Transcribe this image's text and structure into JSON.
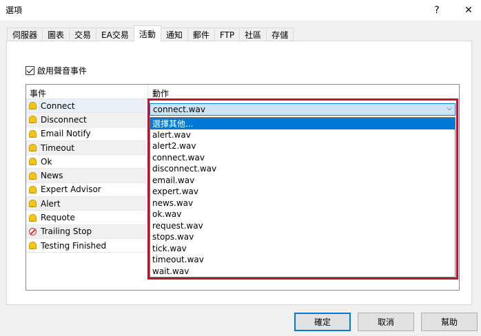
{
  "window": {
    "title": "選項",
    "help_glyph": "?",
    "close_glyph": "✕"
  },
  "tabs": [
    {
      "label": "伺服器"
    },
    {
      "label": "圖表"
    },
    {
      "label": "交易"
    },
    {
      "label": "EA交易"
    },
    {
      "label": "活動",
      "active": true
    },
    {
      "label": "通知"
    },
    {
      "label": "郵件"
    },
    {
      "label": "FTP"
    },
    {
      "label": "社區"
    },
    {
      "label": "存儲"
    }
  ],
  "enable_sound": {
    "label": "啟用聲音事件",
    "checked": true
  },
  "table": {
    "col_event": "事件",
    "col_action": "動作",
    "rows": [
      {
        "event": "Connect",
        "icon": "bell-icon"
      },
      {
        "event": "Disconnect",
        "icon": "bell-icon"
      },
      {
        "event": "Email Notify",
        "icon": "bell-icon"
      },
      {
        "event": "Timeout",
        "icon": "bell-icon"
      },
      {
        "event": "Ok",
        "icon": "bell-icon"
      },
      {
        "event": "News",
        "icon": "bell-icon"
      },
      {
        "event": "Expert Advisor",
        "icon": "bell-icon"
      },
      {
        "event": "Alert",
        "icon": "bell-icon"
      },
      {
        "event": "Requote",
        "icon": "bell-icon"
      },
      {
        "event": "Trailing Stop",
        "icon": "disabled-icon"
      },
      {
        "event": "Testing Finished",
        "icon": "bell-icon"
      }
    ]
  },
  "combo": {
    "value": "connect.wav",
    "options": [
      "選擇其他...",
      "alert.wav",
      "alert2.wav",
      "connect.wav",
      "disconnect.wav",
      "email.wav",
      "expert.wav",
      "news.wav",
      "ok.wav",
      "request.wav",
      "stops.wav",
      "tick.wav",
      "timeout.wav",
      "wait.wav"
    ]
  },
  "buttons": {
    "ok": "確定",
    "cancel": "取消",
    "help": "幫助"
  },
  "colors": {
    "accent": "#0078d7",
    "highlight_frame": "#c8102e"
  }
}
